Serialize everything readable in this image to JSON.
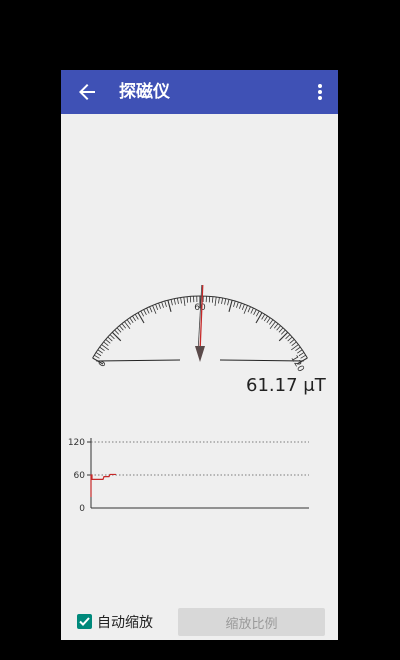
{
  "app": {
    "title": "探磁仪",
    "back_icon": "arrow-left-icon",
    "menu_icon": "more-vertical-icon",
    "accent_color": "#3f51b5"
  },
  "gauge": {
    "min_label": "0",
    "mid_label": "60",
    "max_label": "120",
    "min": 0,
    "max": 120,
    "needle_value": 61.17,
    "needle_color": "#c62828"
  },
  "reading": {
    "text": "61.17 μT"
  },
  "chart_data": {
    "type": "line",
    "ylim": [
      0,
      120
    ],
    "y_ticks": [
      "0",
      "60",
      "120"
    ],
    "grid": "dotted at 60 and 120",
    "series": [
      {
        "color": "#c62828",
        "x": [
          0,
          0,
          1,
          1,
          12,
          13,
          18,
          19,
          25
        ],
        "y": [
          20,
          60,
          60,
          52,
          52,
          57,
          57,
          61,
          61
        ]
      }
    ]
  },
  "controls": {
    "auto_zoom_label": "自动缩放",
    "auto_zoom_checked": true,
    "scale_button_label": "缩放比例",
    "check_color": "#00897b"
  }
}
